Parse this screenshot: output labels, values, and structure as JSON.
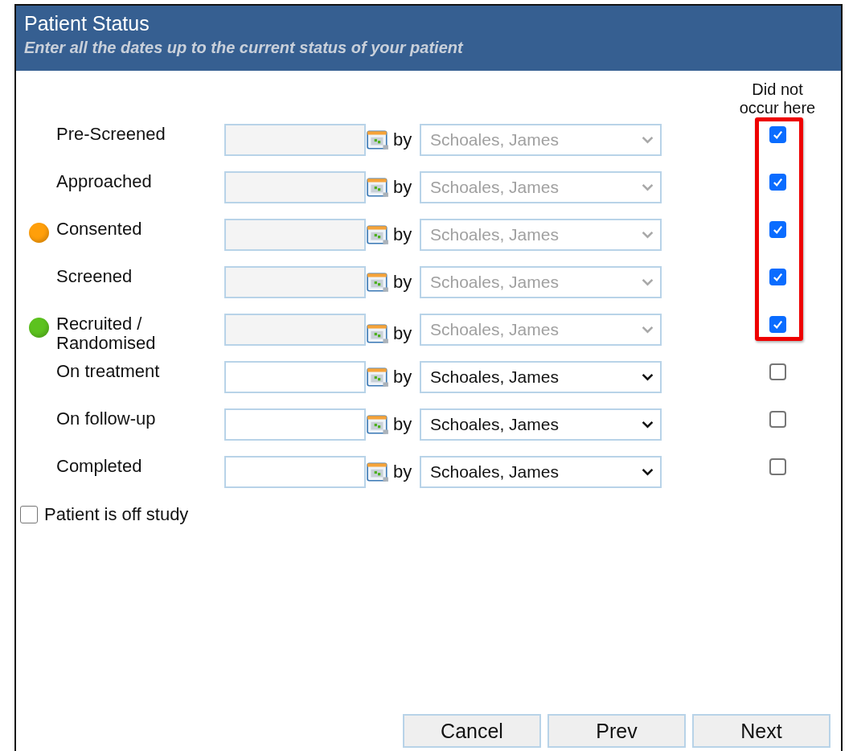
{
  "header": {
    "title": "Patient Status",
    "subtitle": "Enter all the dates up to the current status of your patient"
  },
  "column_heading": "Did not occur here",
  "rows": [
    {
      "label": "Pre-Screened",
      "by": "by",
      "staff": "Schoales, James",
      "disabled": true,
      "did_not_occur": true,
      "highlighted": true
    },
    {
      "label": "Approached",
      "by": "by",
      "staff": "Schoales, James",
      "disabled": true,
      "did_not_occur": true,
      "highlighted": true
    },
    {
      "label": "Consented",
      "color": "#ff9f0a",
      "by": "by",
      "staff": "Schoales, James",
      "disabled": true,
      "did_not_occur": true,
      "highlighted": true
    },
    {
      "label": "Screened",
      "by": "by",
      "staff": "Schoales, James",
      "disabled": true,
      "did_not_occur": true,
      "highlighted": true
    },
    {
      "label": "Recruited / Randomised",
      "color": "#5cc21e",
      "by": "by",
      "staff": "Schoales, James",
      "disabled": true,
      "did_not_occur": true,
      "highlighted": true
    },
    {
      "label": "On treatment",
      "by": "by",
      "staff": "Schoales, James",
      "disabled": false,
      "did_not_occur": false,
      "highlighted": false
    },
    {
      "label": "On follow-up",
      "by": "by",
      "staff": "Schoales, James",
      "disabled": false,
      "did_not_occur": false,
      "highlighted": false
    },
    {
      "label": "Completed",
      "by": "by",
      "staff": "Schoales, James",
      "disabled": false,
      "did_not_occur": false,
      "highlighted": false
    }
  ],
  "off_study": {
    "label": "Patient is off study",
    "checked": false
  },
  "buttons": [
    "Cancel",
    "Prev",
    "Next"
  ]
}
